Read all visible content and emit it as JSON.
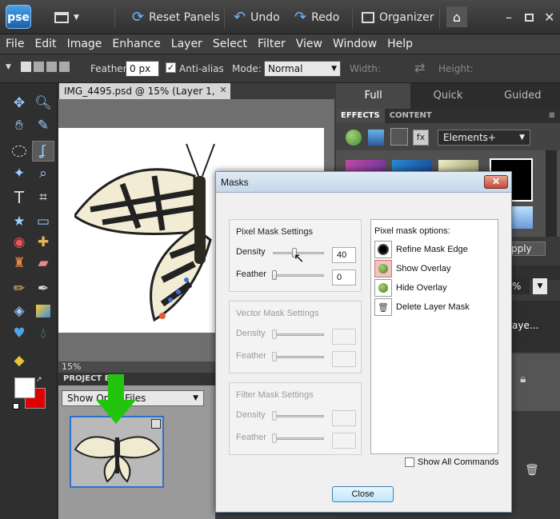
{
  "app": {
    "logo": "pse"
  },
  "toolbar": {
    "reset_panels": "Reset Panels",
    "undo": "Undo",
    "redo": "Redo",
    "organizer": "Organizer"
  },
  "menu": [
    "File",
    "Edit",
    "Image",
    "Enhance",
    "Layer",
    "Select",
    "Filter",
    "View",
    "Window",
    "Help"
  ],
  "options": {
    "feather_label": "Feather:",
    "feather_value": "0 px",
    "antialias_label": "Anti-alias",
    "mode_label": "Mode:",
    "mode_value": "Normal",
    "width_label": "Width:",
    "height_label": "Height:"
  },
  "document": {
    "tab_title": "IMG_4495.psd @ 15% (Layer 1, RGB/8) *",
    "zoom": "15%"
  },
  "project_bin": {
    "title": "PROJECT BIN",
    "select_value": "Show Open Files"
  },
  "right_panel": {
    "modes": [
      "Full",
      "Quick",
      "Guided"
    ],
    "tabs": [
      "EFFECTS",
      "CONTENT"
    ],
    "effects_select": "Elements+",
    "partial_button": "pply",
    "partial_zoom": "%",
    "partial_layer": "aye..."
  },
  "dialog": {
    "title": "Masks",
    "pixel": {
      "title": "Pixel Mask Settings",
      "density_label": "Density",
      "density_value": "40",
      "density_level": 0.4,
      "feather_label": "Feather",
      "feather_value": "0"
    },
    "vector": {
      "title": "Vector Mask Settings",
      "density_label": "Density",
      "feather_label": "Feather"
    },
    "filter": {
      "title": "Filter Mask Settings",
      "density_label": "Density",
      "feather_label": "Feather"
    },
    "options_title": "Pixel mask options:",
    "options": [
      {
        "label": "Refine Mask Edge",
        "icon": "refine-edge-icon"
      },
      {
        "label": "Show Overlay",
        "icon": "show-overlay-icon"
      },
      {
        "label": "Hide Overlay",
        "icon": "hide-overlay-icon"
      },
      {
        "label": "Delete Layer Mask",
        "icon": "trash-icon"
      }
    ],
    "show_all_commands": "Show All Commands",
    "close_button": "Close"
  }
}
